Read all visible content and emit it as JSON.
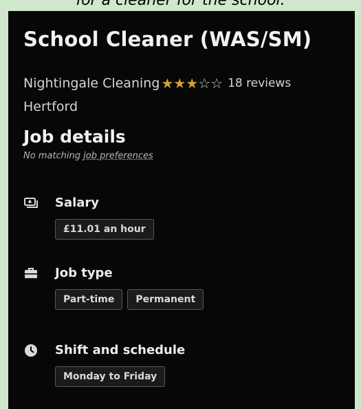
{
  "caption": "for a cleaner for the school.",
  "job": {
    "title": "School Cleaner (WAS/SM)",
    "company": "Nightingale Cleaning",
    "rating_stars": 3,
    "rating_max": 5,
    "reviews": "18 reviews",
    "location": "Hertford"
  },
  "details": {
    "heading": "Job details",
    "prefs_prefix": "No matching ",
    "prefs_link": "job preferences",
    "salary": {
      "label": "Salary",
      "icon": "money-icon",
      "values": [
        "£11.01 an hour"
      ]
    },
    "job_type": {
      "label": "Job type",
      "icon": "briefcase-icon",
      "values": [
        "Part-time",
        "Permanent"
      ]
    },
    "schedule": {
      "label": "Shift and schedule",
      "icon": "clock-icon",
      "values": [
        "Monday to Friday"
      ]
    }
  },
  "colors": {
    "background": "#cfe8cb",
    "panel": "#070707",
    "star_filled": "#d6a329"
  }
}
